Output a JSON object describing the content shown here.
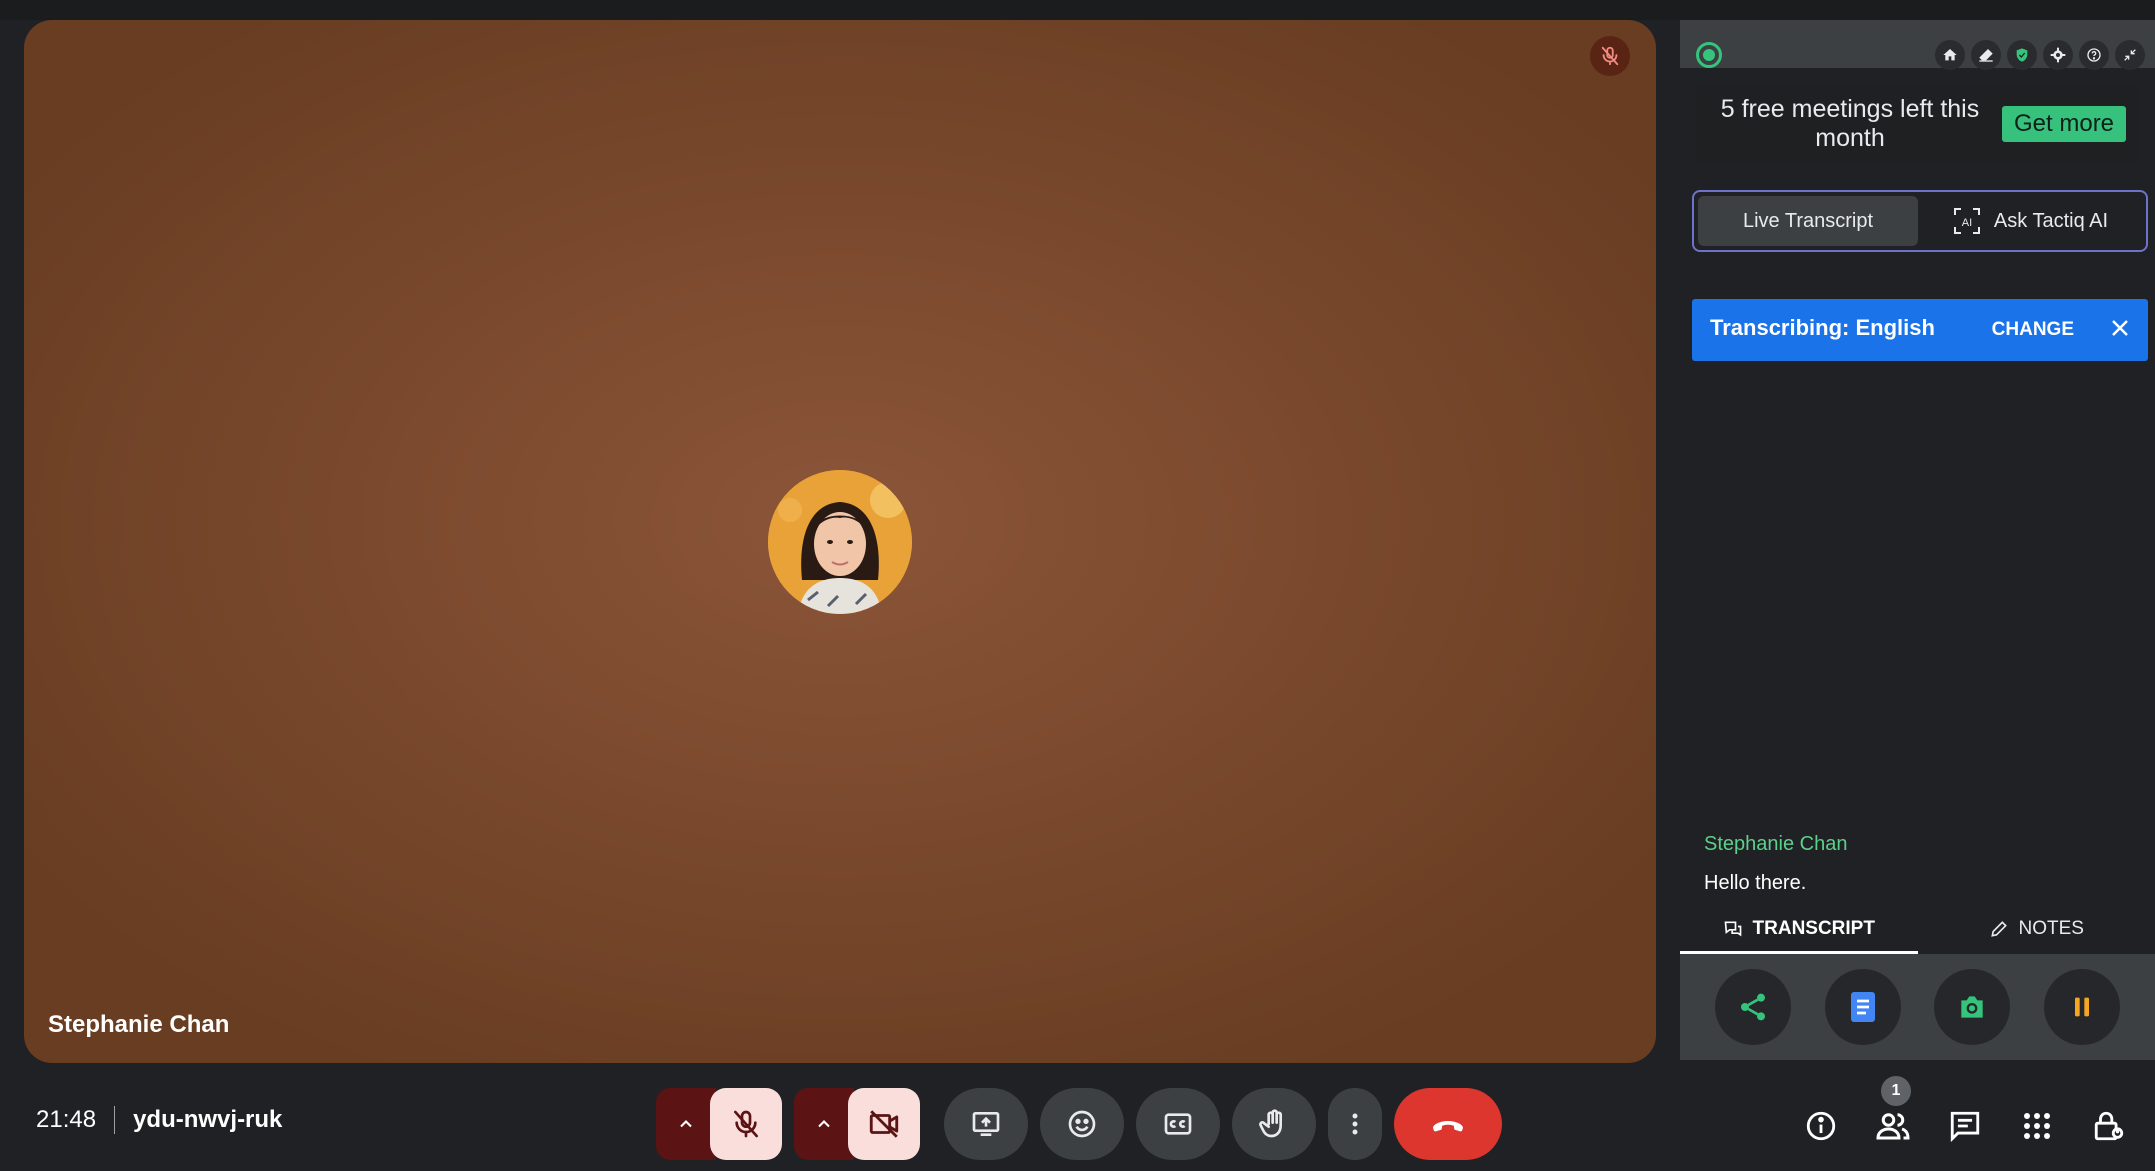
{
  "meeting": {
    "participant_name": "Stephanie Chan",
    "time": "21:48",
    "code": "ydu-nwvj-ruk",
    "people_count": "1"
  },
  "panel": {
    "promo_text": "5 free meetings left this month",
    "promo_button": "Get more",
    "tab_live": "Live Transcript",
    "tab_ask": "Ask Tactiq AI",
    "banner_label": "Transcribing: English",
    "banner_change": "CHANGE",
    "transcript_speaker": "Stephanie Chan",
    "transcript_text": "Hello there.",
    "bottom_tab_transcript": "TRANSCRIPT",
    "bottom_tab_notes": "NOTES"
  },
  "colors": {
    "tile_bg": "#7c4a2e",
    "end_call": "#dc362e",
    "accent_green": "#36c27d",
    "banner_blue": "#1a73e8"
  },
  "icons": {
    "panel_tools": [
      "home-icon",
      "eraser-icon",
      "shield-icon",
      "gear-icon",
      "help-icon",
      "collapse-icon"
    ],
    "controls": [
      "chevron-up-icon",
      "mic-off-icon",
      "chevron-up-icon",
      "camera-off-icon",
      "present-icon",
      "emoji-icon",
      "captions-icon",
      "raise-hand-icon",
      "more-vert-icon",
      "end-call-icon"
    ],
    "right": [
      "info-icon",
      "people-icon",
      "chat-icon",
      "apps-icon",
      "lock-person-icon"
    ],
    "panel_actions": [
      "share-icon",
      "doc-icon",
      "camera-icon",
      "pause-icon"
    ]
  }
}
